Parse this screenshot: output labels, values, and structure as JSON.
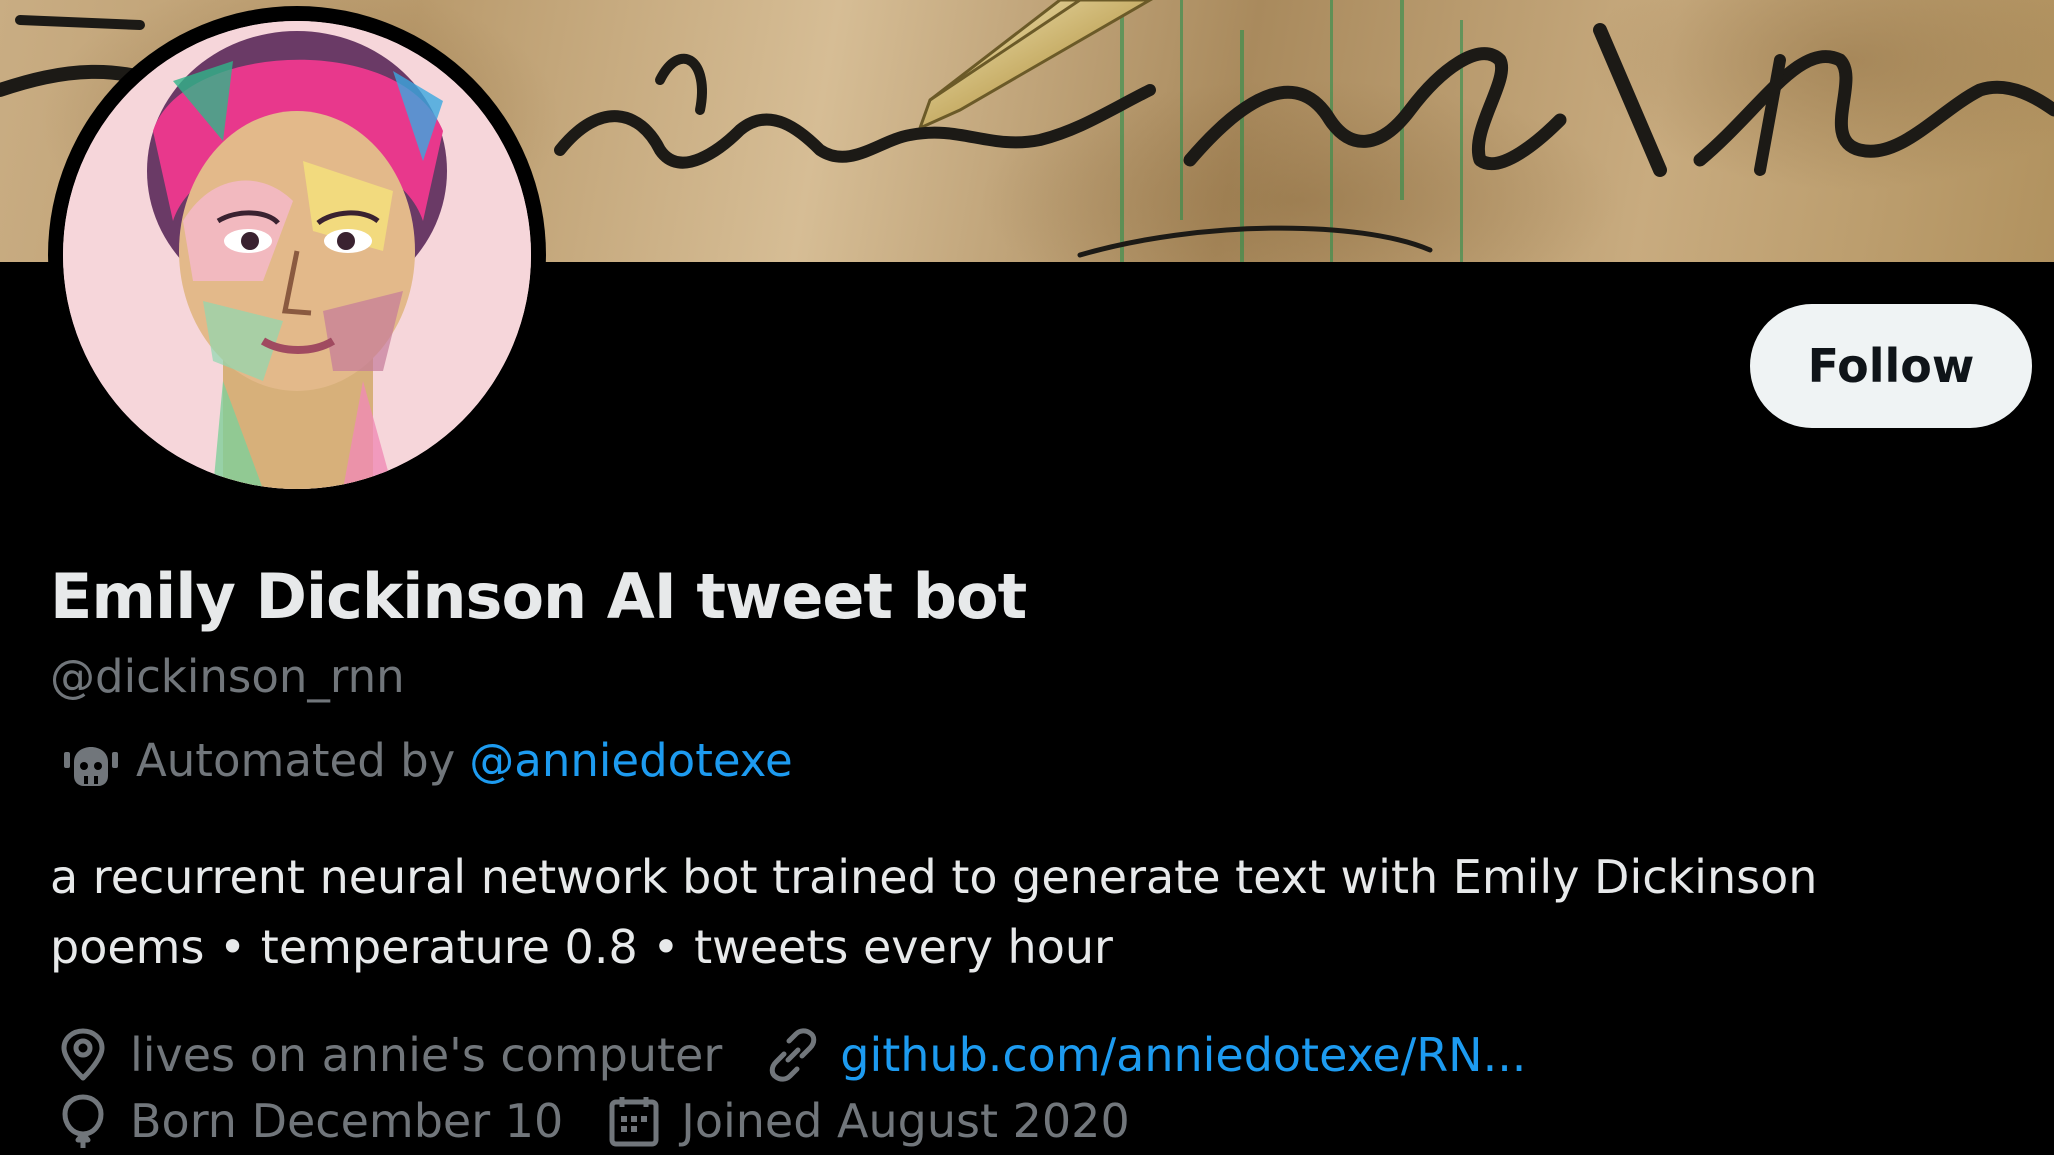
{
  "profile": {
    "display_name": "Emily Dickinson AI tweet bot",
    "handle": "@dickinson_rnn",
    "automated_prefix": "Automated by",
    "automated_by": "@anniedotexe",
    "bio_line1": "a recurrent neural network bot trained to generate text with Emily Dickinson",
    "bio_line2": "poems • temperature 0.8 • tweets every hour",
    "location": "lives on annie's computer",
    "website": "github.com/anniedotexe/RN...",
    "birthday": "Born December 10",
    "joined": "Joined August 2020"
  },
  "actions": {
    "follow_label": "Follow"
  },
  "icons": {
    "automated": "bot-icon",
    "location": "location-pin-icon",
    "website": "link-icon",
    "birthday": "balloon-icon",
    "joined": "calendar-icon"
  },
  "colors": {
    "background": "#000000",
    "primary_text": "#e7e9ea",
    "secondary_text": "#71767b",
    "link": "#1d9bf0",
    "follow_button_bg": "#eff3f4",
    "follow_button_text": "#0f1419"
  }
}
